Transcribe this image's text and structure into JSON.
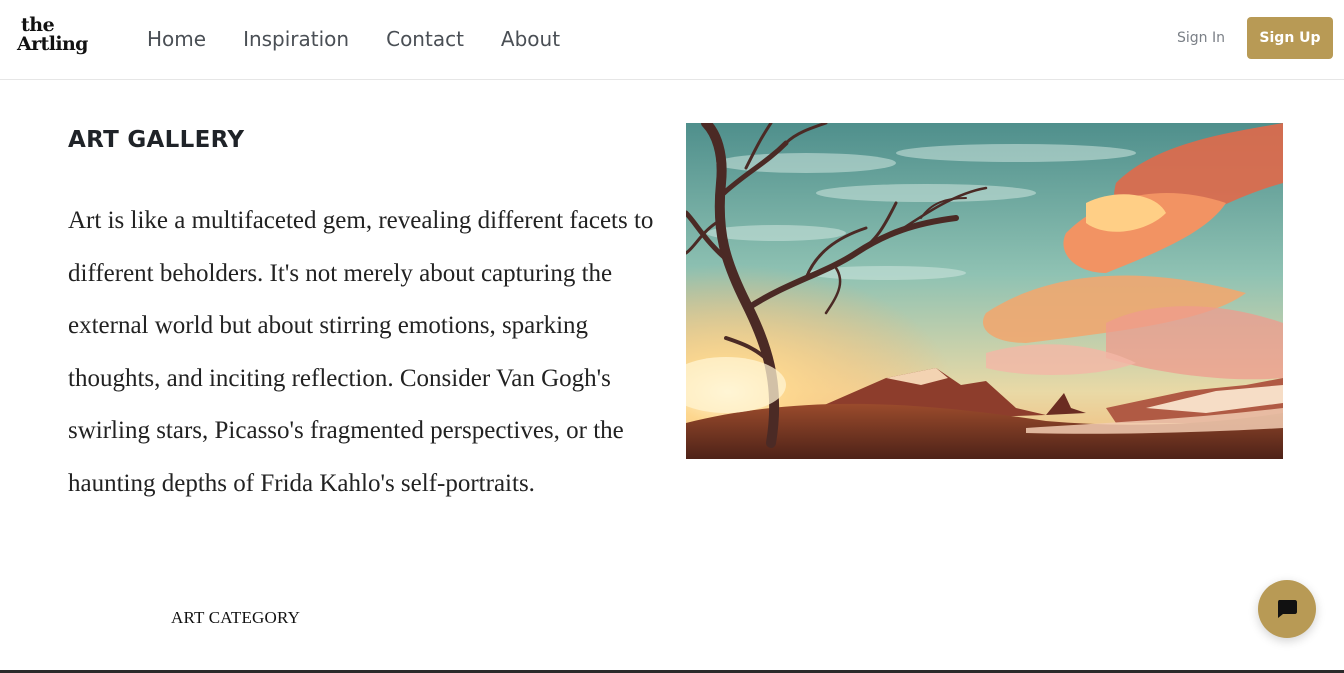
{
  "header": {
    "logo": {
      "line1": "the",
      "line2": "Artling"
    },
    "nav": [
      "Home",
      "Inspiration",
      "Contact",
      "About"
    ],
    "sign_in_label": "Sign In",
    "sign_up_label": "Sign Up"
  },
  "main": {
    "title": "ART GALLERY",
    "description": "Art is like a multifaceted gem, revealing different facets to different beholders. It's not merely about capturing the external world but about stirring emotions, sparking thoughts, and inciting reflection. Consider Van Gogh's swirling stars, Picasso's fragmented perspectives, or the haunting depths of Frida Kahlo's self-portraits.",
    "category_heading": "ART CATEGORY"
  },
  "chat": {
    "icon": "chat-bubble-icon"
  },
  "colors": {
    "accent": "#b89a55",
    "text": "#1f2328",
    "nav_text": "#4a4f55"
  }
}
